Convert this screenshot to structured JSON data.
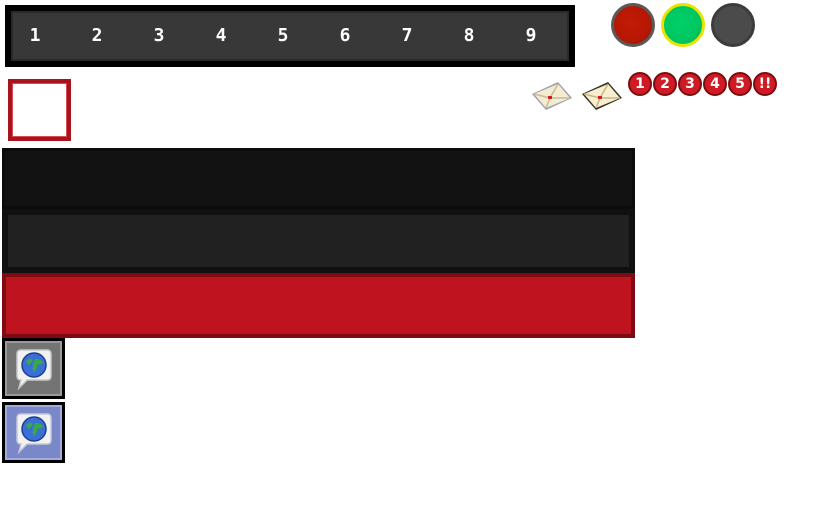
{
  "hotbar": {
    "slots": [
      "1",
      "2",
      "3",
      "4",
      "5",
      "6",
      "7",
      "8",
      "9"
    ]
  },
  "status_lights": {
    "red": "#c41a05",
    "green": "#00c65f",
    "gray": "#4b4b4b"
  },
  "mail": {
    "envelope_icon": "envelope-icon",
    "badges": [
      "1",
      "2",
      "3",
      "4",
      "5",
      "!!"
    ]
  },
  "bars": {
    "colors": [
      "#121212",
      "#212121",
      "#c01320"
    ]
  },
  "chat_buttons": {
    "icon": "globe-chat-icon",
    "colors": [
      "#747474",
      "#7a87c8"
    ]
  }
}
